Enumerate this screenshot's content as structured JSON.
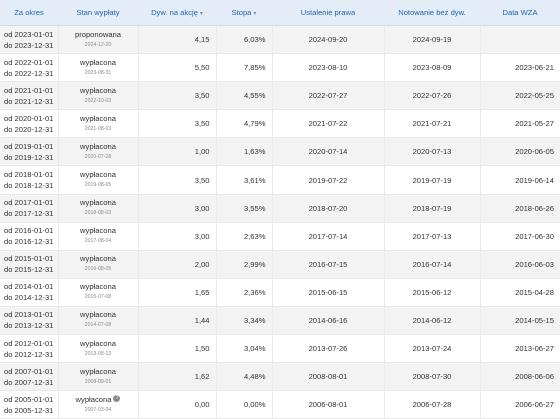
{
  "headers": {
    "period": "Za okres",
    "status": "Stan wypłaty",
    "dividend": "Dyw. na akcję",
    "rate": "Stopa",
    "record_date": "Ustalenie prawa",
    "ex_date": "Notowanie bez dyw.",
    "agm_date": "Data WZA",
    "sort_icon": "sort-icon"
  },
  "rows": [
    {
      "from": "od 2023-01-01",
      "to": "do 2023-12-31",
      "status": "proponowana",
      "status_date": "2024-12-20",
      "dividend": "4,15",
      "rate": "6,03%",
      "record_date": "2024-09-20",
      "ex_date": "2024-09-19",
      "agm_date": ""
    },
    {
      "from": "od 2022-01-01",
      "to": "do 2022-12-31",
      "status": "wypłacona",
      "status_date": "2023-08-31",
      "dividend": "5,50",
      "rate": "7,85%",
      "record_date": "2023-08-10",
      "ex_date": "2023-08-09",
      "agm_date": "2023-06-21"
    },
    {
      "from": "od 2021-01-01",
      "to": "do 2021-12-31",
      "status": "wypłacona",
      "status_date": "2022-10-03",
      "dividend": "3,50",
      "rate": "4,55%",
      "record_date": "2022-07-27",
      "ex_date": "2022-07-26",
      "agm_date": "2022-05-25"
    },
    {
      "from": "od 2020-01-01",
      "to": "do 2020-12-31",
      "status": "wypłacona",
      "status_date": "2021-08-03",
      "dividend": "3,50",
      "rate": "4,79%",
      "record_date": "2021-07-22",
      "ex_date": "2021-07-21",
      "agm_date": "2021-05-27"
    },
    {
      "from": "od 2019-01-01",
      "to": "do 2019-12-31",
      "status": "wypłacona",
      "status_date": "2020-07-28",
      "dividend": "1,00",
      "rate": "1,63%",
      "record_date": "2020-07-14",
      "ex_date": "2020-07-13",
      "agm_date": "2020-06-05"
    },
    {
      "from": "od 2018-01-01",
      "to": "do 2018-12-31",
      "status": "wypłacona",
      "status_date": "2019-08-05",
      "dividend": "3,50",
      "rate": "3,61%",
      "record_date": "2019-07-22",
      "ex_date": "2019-07-19",
      "agm_date": "2019-06-14"
    },
    {
      "from": "od 2017-01-01",
      "to": "do 2017-12-31",
      "status": "wypłacona",
      "status_date": "2018-08-03",
      "dividend": "3,00",
      "rate": "3,55%",
      "record_date": "2018-07-20",
      "ex_date": "2018-07-19",
      "agm_date": "2018-06-26"
    },
    {
      "from": "od 2016-01-01",
      "to": "do 2016-12-31",
      "status": "wypłacona",
      "status_date": "2017-08-04",
      "dividend": "3,00",
      "rate": "2,63%",
      "record_date": "2017-07-14",
      "ex_date": "2017-07-13",
      "agm_date": "2017-06-30"
    },
    {
      "from": "od 2015-01-01",
      "to": "do 2015-12-31",
      "status": "wypłacona",
      "status_date": "2016-08-05",
      "dividend": "2,00",
      "rate": "2,99%",
      "record_date": "2016-07-15",
      "ex_date": "2016-07-14",
      "agm_date": "2016-06-03"
    },
    {
      "from": "od 2014-01-01",
      "to": "do 2014-12-31",
      "status": "wypłacona",
      "status_date": "2015-07-08",
      "dividend": "1,65",
      "rate": "2,36%",
      "record_date": "2015-06-15",
      "ex_date": "2015-06-12",
      "agm_date": "2015-04-28"
    },
    {
      "from": "od 2013-01-01",
      "to": "do 2013-12-31",
      "status": "wypłacona",
      "status_date": "2014-07-08",
      "dividend": "1,44",
      "rate": "3,34%",
      "record_date": "2014-06-16",
      "ex_date": "2014-06-12",
      "agm_date": "2014-05-15"
    },
    {
      "from": "od 2012-01-01",
      "to": "do 2012-12-31",
      "status": "wypłacona",
      "status_date": "2013-08-13",
      "dividend": "1,50",
      "rate": "3,04%",
      "record_date": "2013-07-26",
      "ex_date": "2013-07-24",
      "agm_date": "2013-06-27"
    },
    {
      "from": "od 2007-01-01",
      "to": "do 2007-12-31",
      "status": "wypłacona",
      "status_date": "2008-09-01",
      "dividend": "1,62",
      "rate": "4,48%",
      "record_date": "2008-08-01",
      "ex_date": "2008-07-30",
      "agm_date": "2008-06-06"
    },
    {
      "from": "od 2005-01-01",
      "to": "do 2005-12-31",
      "status": "wypłacona",
      "status_date": "2007-03-04",
      "dividend": "0,00",
      "rate": "0,00%",
      "record_date": "2006-08-01",
      "ex_date": "2006-07-28",
      "agm_date": "2006-06-27",
      "help": "?"
    }
  ]
}
